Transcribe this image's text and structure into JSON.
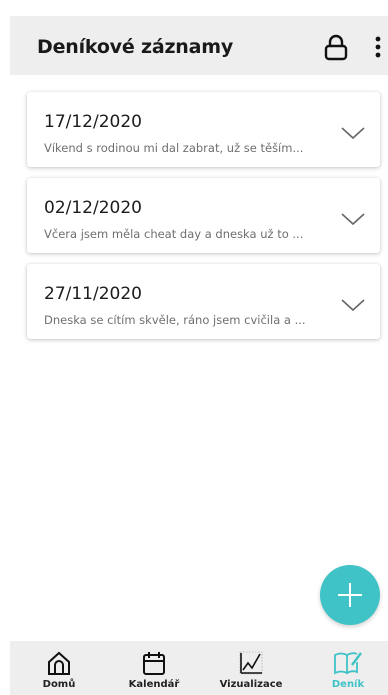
{
  "header": {
    "title": "Deníkové záznamy"
  },
  "entries": [
    {
      "date": "17/12/2020",
      "preview": "Víkend s rodinou mi dal zabrat, už se těším..."
    },
    {
      "date": "02/12/2020",
      "preview": "Včera jsem měla cheat day a dneska už to ..."
    },
    {
      "date": "27/11/2020",
      "preview": "Dneska se cítím skvěle, ráno jsem cvičila a ..."
    }
  ],
  "fab": {
    "icon": "plus-icon"
  },
  "nav": {
    "items": [
      {
        "label": "Domů",
        "icon": "home-icon"
      },
      {
        "label": "Kalendář",
        "icon": "calendar-icon"
      },
      {
        "label": "Vizualizace",
        "icon": "chart-icon"
      },
      {
        "label": "Deník",
        "icon": "diary-icon"
      }
    ],
    "active_index": 3
  },
  "colors": {
    "accent": "#3fc3c7",
    "header_bg": "#eeeeee",
    "nav_bg": "#eeeeee"
  }
}
